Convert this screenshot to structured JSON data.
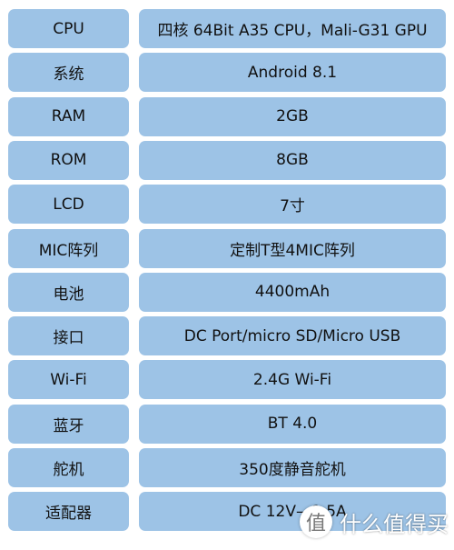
{
  "specs": [
    {
      "key": "CPU",
      "value": "四核 64Bit A35 CPU，Mali-G31 GPU"
    },
    {
      "key": "系统",
      "value": "Android 8.1"
    },
    {
      "key": "RAM",
      "value": "2GB"
    },
    {
      "key": "ROM",
      "value": "8GB"
    },
    {
      "key": "LCD",
      "value": "7寸"
    },
    {
      "key": "MIC阵列",
      "value": "定制T型4MIC阵列"
    },
    {
      "key": "电池",
      "value": "4400mAh"
    },
    {
      "key": "接口",
      "value": "DC Port/micro SD/Micro USB"
    },
    {
      "key": "Wi-Fi",
      "value": "2.4G Wi-Fi"
    },
    {
      "key": "蓝牙",
      "value": "BT 4.0"
    },
    {
      "key": "舵机",
      "value": "350度静音舵机"
    },
    {
      "key": "适配器",
      "value": "DC 12V—1.5A"
    }
  ],
  "colors": {
    "cell": "#9dc3e6"
  },
  "watermark": {
    "badge": "值",
    "text": "什么值得买"
  }
}
